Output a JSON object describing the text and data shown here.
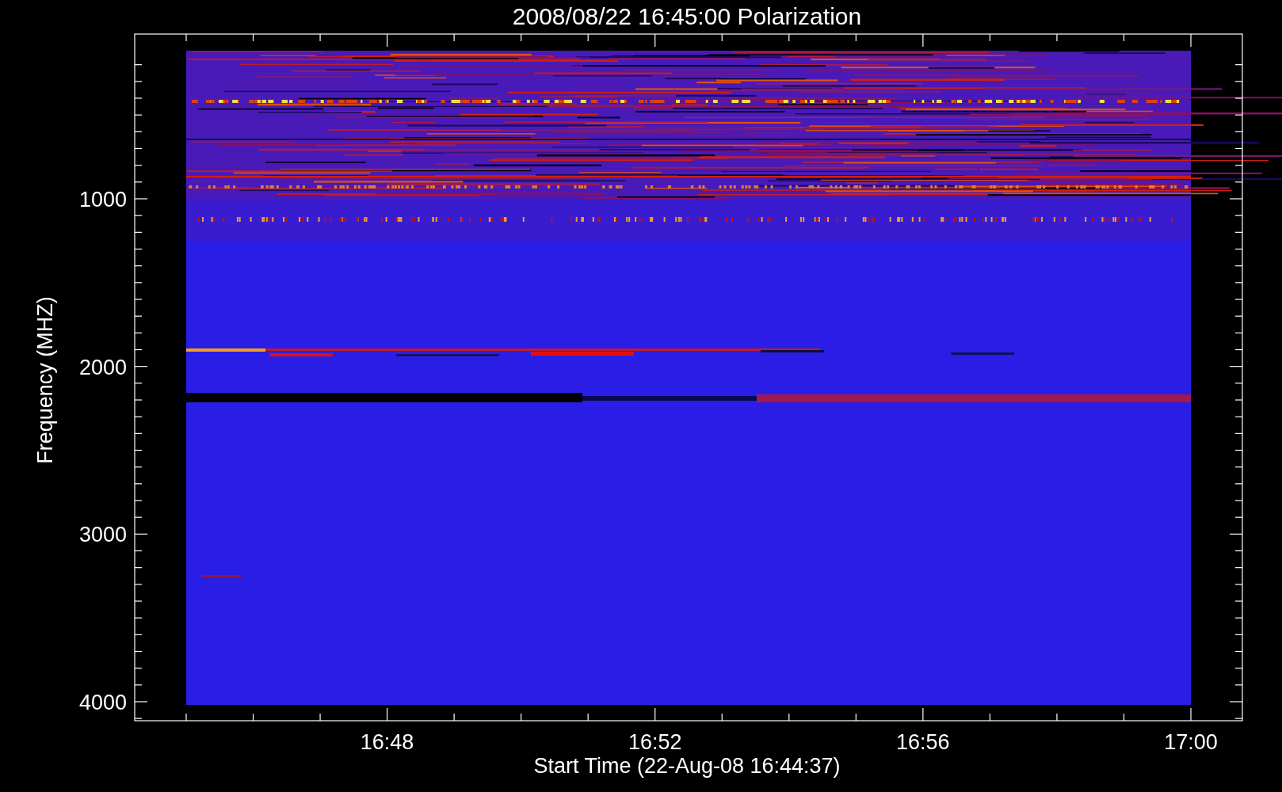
{
  "title": "2008/08/22 16:45:00 Polarization",
  "y_axis": {
    "label": "Frequency (MHZ)",
    "ticks": [
      "1000",
      "2000",
      "3000",
      "4000"
    ]
  },
  "x_axis": {
    "label": "Start Time (22-Aug-08 16:44:37)",
    "ticks": [
      "16:48",
      "16:52",
      "16:56",
      "17:00"
    ]
  }
}
